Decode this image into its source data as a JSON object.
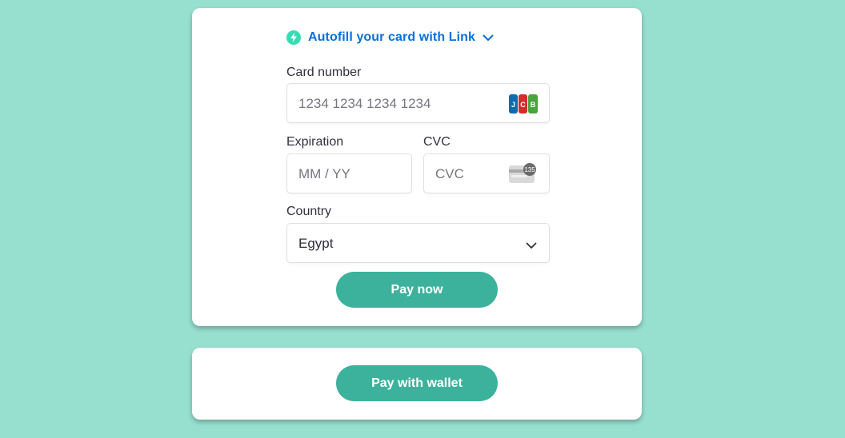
{
  "colors": {
    "background": "#97dfcf",
    "card": "#ffffff",
    "link_blue": "#0570de",
    "link_green": "#33ddb3",
    "button": "#3cb29c"
  },
  "link": {
    "label": "Autofill your card with Link",
    "icon": "lightning-bolt-icon",
    "chevron_icon": "chevron-down-icon"
  },
  "card_number": {
    "label": "Card number",
    "placeholder": "1234 1234 1234 1234",
    "brand_icon": "jcb-card-icon"
  },
  "expiration": {
    "label": "Expiration",
    "placeholder": "MM / YY"
  },
  "cvc": {
    "label": "CVC",
    "placeholder": "CVC",
    "icon": "cvc-card-icon",
    "icon_text": "135"
  },
  "country": {
    "label": "Country",
    "selected": "Egypt",
    "chevron_icon": "chevron-down-icon"
  },
  "pay_now_button": "Pay now",
  "wallet_button": "Pay with wallet"
}
